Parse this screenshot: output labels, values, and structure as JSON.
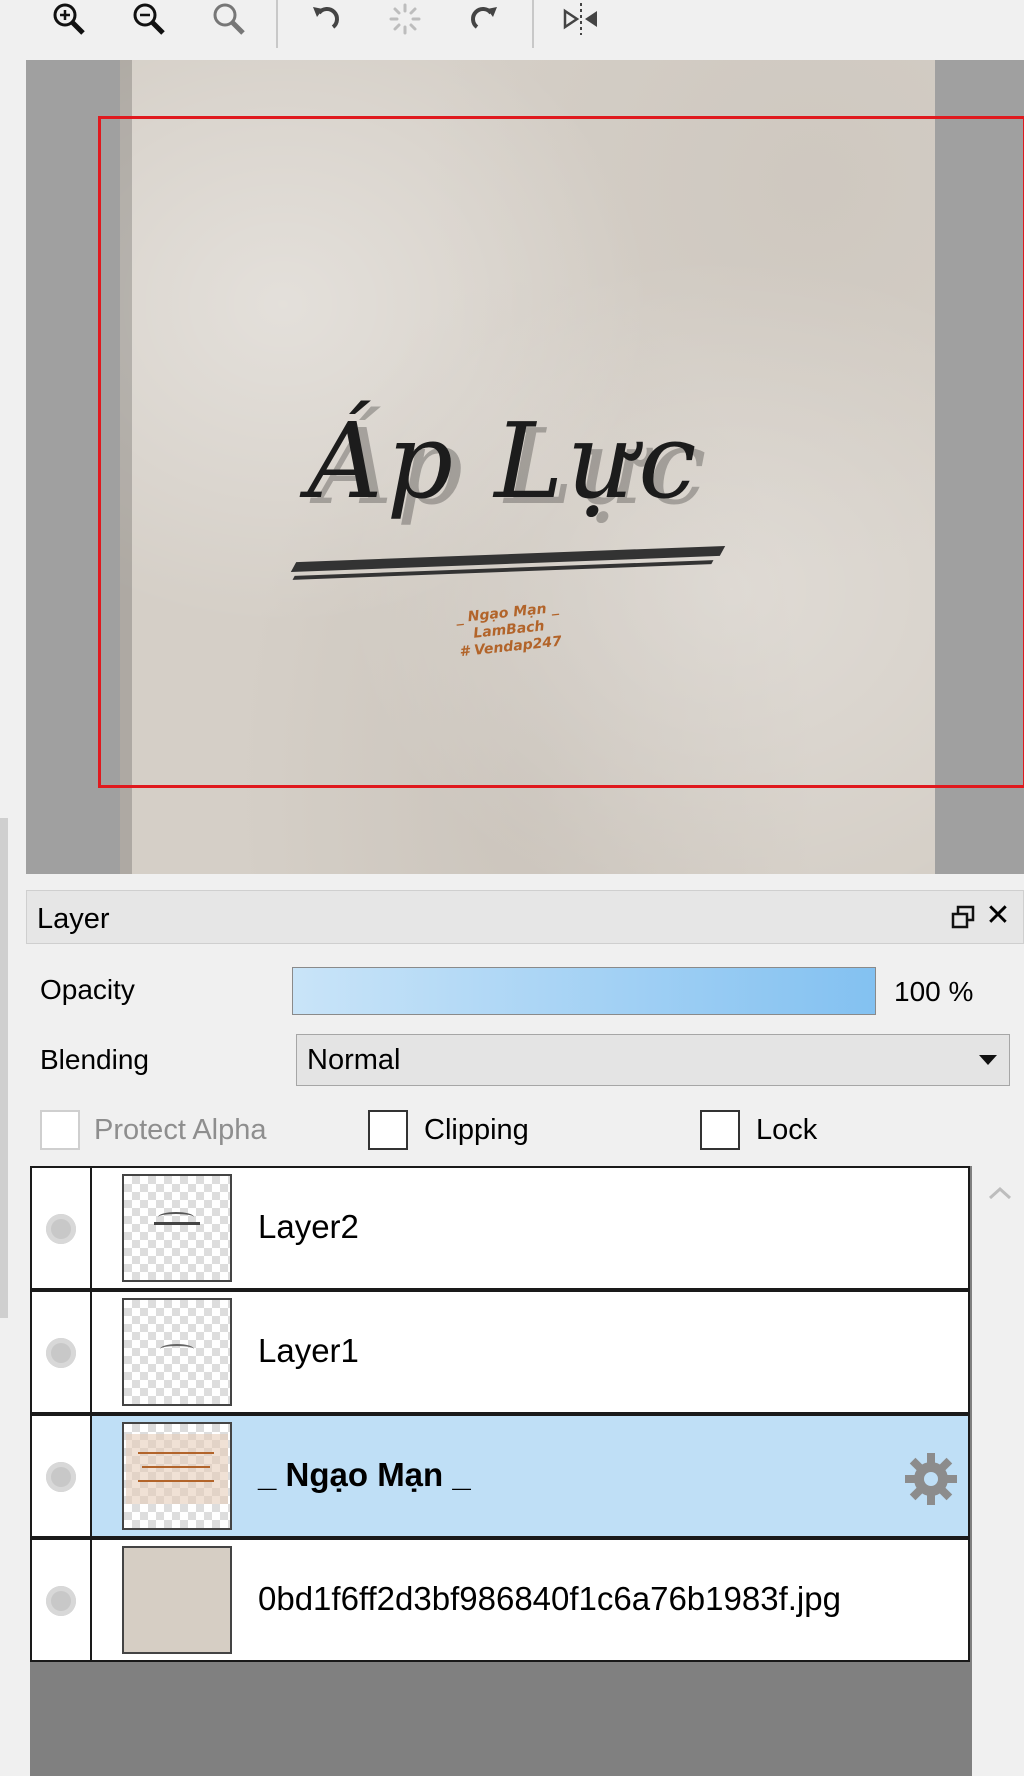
{
  "toolbar": {
    "buttons": [
      {
        "name": "zoom-in-icon"
      },
      {
        "name": "zoom-out-icon"
      },
      {
        "name": "zoom-fit-icon"
      },
      {
        "name": "rotate-left-icon"
      },
      {
        "name": "reset-rotation-icon"
      },
      {
        "name": "rotate-right-icon"
      },
      {
        "name": "flip-horizontal-icon"
      }
    ]
  },
  "canvas": {
    "artwork_text": "Áp Lực",
    "caption_lines": [
      "_ Ngạo Mạn _",
      "LamBach",
      "# Vendap247"
    ],
    "selection_color": "#e0191e"
  },
  "layer_panel": {
    "title": "Layer",
    "opacity_label": "Opacity",
    "opacity_value": "100 %",
    "opacity_fraction": 1.0,
    "blending_label": "Blending",
    "blending_value": "Normal",
    "protect_alpha_label": "Protect Alpha",
    "clipping_label": "Clipping",
    "lock_label": "Lock",
    "layers": [
      {
        "name": "Layer2",
        "selected": false
      },
      {
        "name": "Layer1",
        "selected": false
      },
      {
        "name": "_ Ngạo Mạn _",
        "selected": true
      },
      {
        "name": "0bd1f6ff2d3bf986840f1c6a76b1983f.jpg",
        "selected": false
      }
    ]
  },
  "colors": {
    "selected_row": "#bfdff6",
    "opacity_bar_start": "#c9e4f8",
    "opacity_bar_end": "#83c1f1"
  }
}
